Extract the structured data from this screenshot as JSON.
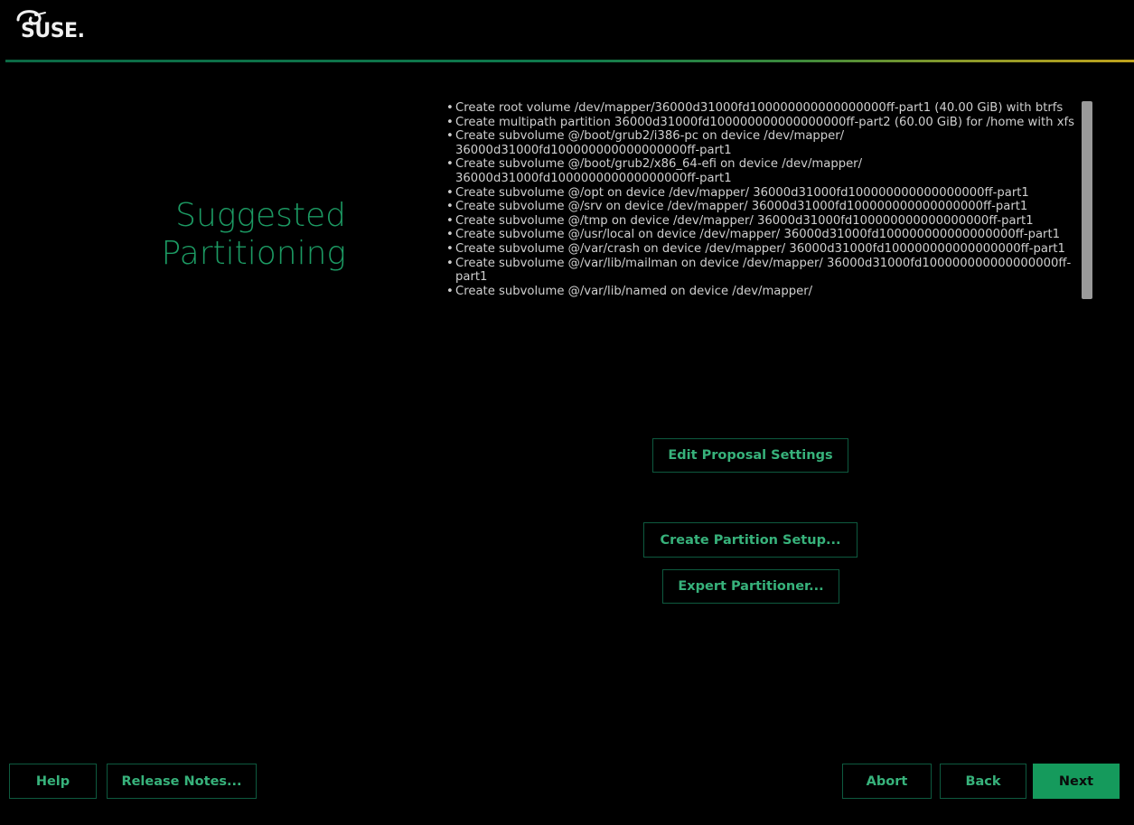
{
  "header": {
    "logo_text": "SUSE.",
    "logo_icon": "chameleon-icon",
    "accent_gradient": [
      "#0c6a45",
      "#c0a21c"
    ]
  },
  "page": {
    "title_line1": "Suggested",
    "title_line2": "Partitioning",
    "title_color": "#1c9a63"
  },
  "proposal": {
    "items": [
      "Create root volume /dev/mapper/36000d31000fd100000000000000000ff-part1 (40.00 GiB) with btrfs",
      "Create multipath partition 36000d31000fd100000000000000000ff-part2 (60.00 GiB) for /home with xfs",
      "Create subvolume @/boot/grub2/i386-pc on device /dev/mapper/ 36000d31000fd100000000000000000ff-part1",
      "Create subvolume @/boot/grub2/x86_64-efi on device /dev/mapper/ 36000d31000fd100000000000000000ff-part1",
      "Create subvolume @/opt on device /dev/mapper/ 36000d31000fd100000000000000000ff-part1",
      "Create subvolume @/srv on device /dev/mapper/ 36000d31000fd100000000000000000ff-part1",
      "Create subvolume @/tmp on device /dev/mapper/ 36000d31000fd100000000000000000ff-part1",
      "Create subvolume @/usr/local on device /dev/mapper/ 36000d31000fd100000000000000000ff-part1",
      "Create subvolume @/var/crash on device /dev/mapper/ 36000d31000fd100000000000000000ff-part1",
      "Create subvolume @/var/lib/mailman on device /dev/mapper/ 36000d31000fd100000000000000000ff-part1",
      "Create subvolume @/var/lib/named on device /dev/mapper/"
    ]
  },
  "buttons": {
    "edit_proposal": "Edit Proposal Settings",
    "create_partition_setup": "Create Partition Setup...",
    "expert_partitioner": "Expert Partitioner...",
    "help": "Help",
    "release_notes": "Release Notes...",
    "abort": "Abort",
    "back": "Back",
    "next": "Next"
  },
  "colors": {
    "button_text": "#37b27b",
    "button_border": "#0e5a3f",
    "primary_bg": "#159a5c"
  }
}
